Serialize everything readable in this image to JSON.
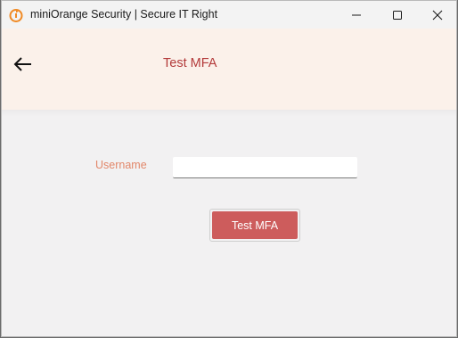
{
  "window": {
    "title": "miniOrange Security | Secure IT Right",
    "controls": {
      "minimize_icon": "minimize-icon",
      "maximize_icon": "maximize-icon",
      "close_icon": "close-icon"
    }
  },
  "header": {
    "back_icon": "arrow-left-icon",
    "title": "Test MFA"
  },
  "form": {
    "username_label": "Username",
    "username_value": "",
    "submit_label": "Test MFA"
  },
  "colors": {
    "accent": "#cd5c5c",
    "title_color": "#b33a3a",
    "label_color": "#e2876a",
    "header_bg": "#fbf1ea",
    "brand_icon": "#f08a24"
  }
}
